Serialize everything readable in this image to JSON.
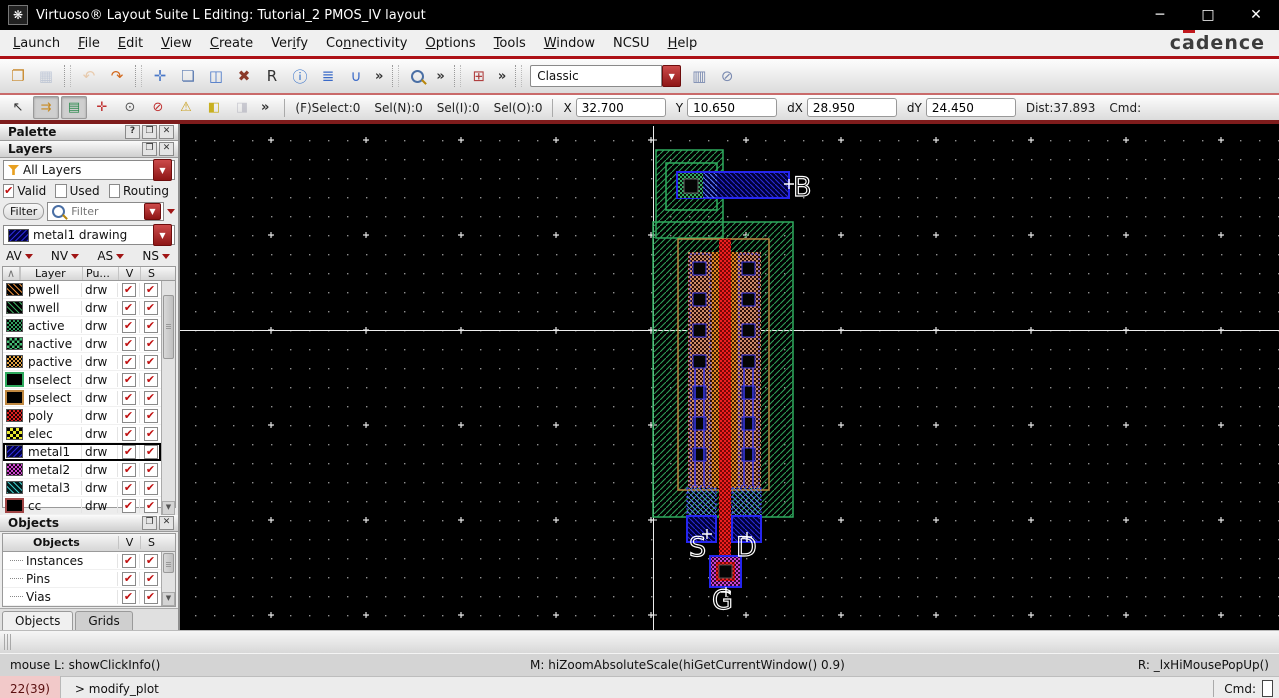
{
  "window": {
    "title": "Virtuoso® Layout Suite L Editing: Tutorial_2 PMOS_IV layout",
    "brand": "cadence",
    "controls": {
      "minimize": "─",
      "maximize": "□",
      "close": "✕"
    }
  },
  "menubar": {
    "items": [
      {
        "label": "Launch",
        "accel": 0
      },
      {
        "label": "File",
        "accel": 0
      },
      {
        "label": "Edit",
        "accel": 0
      },
      {
        "label": "View",
        "accel": 0
      },
      {
        "label": "Create",
        "accel": 0
      },
      {
        "label": "Verify",
        "accel": 3
      },
      {
        "label": "Connectivity",
        "accel": 2
      },
      {
        "label": "Options",
        "accel": 0
      },
      {
        "label": "Tools",
        "accel": 0
      },
      {
        "label": "Window",
        "accel": 0
      },
      {
        "label": "NCSU",
        "accel": -1
      },
      {
        "label": "Help",
        "accel": 0
      }
    ]
  },
  "toolbar_main": {
    "items": [
      {
        "type": "button",
        "name": "open"
      },
      {
        "type": "button",
        "name": "save",
        "disabled": true
      },
      {
        "type": "sep"
      },
      {
        "type": "button",
        "name": "undo",
        "disabled": true
      },
      {
        "type": "button",
        "name": "redo"
      },
      {
        "type": "sep"
      },
      {
        "type": "button",
        "name": "move"
      },
      {
        "type": "button",
        "name": "copy"
      },
      {
        "type": "button",
        "name": "stretch"
      },
      {
        "type": "button",
        "name": "delete"
      },
      {
        "type": "button",
        "name": "properties"
      },
      {
        "type": "button",
        "name": "info"
      },
      {
        "type": "button",
        "name": "align"
      },
      {
        "type": "button",
        "name": "route"
      },
      {
        "type": "chevron"
      },
      {
        "type": "sep"
      },
      {
        "type": "button",
        "name": "zoom-in"
      },
      {
        "type": "chevron"
      },
      {
        "type": "sep"
      },
      {
        "type": "button",
        "name": "create-via"
      },
      {
        "type": "chevron"
      },
      {
        "type": "sep"
      },
      {
        "type": "combo",
        "name": "workspace-select",
        "value": "Classic"
      },
      {
        "type": "button",
        "name": "save-workspace"
      },
      {
        "type": "button",
        "name": "hide-workspace"
      }
    ],
    "overflow_glyph": "»"
  },
  "toolbar_edit": {
    "icons": [
      {
        "name": "select-mode"
      },
      {
        "name": "partial-select",
        "pressed": true
      },
      {
        "name": "layer-visibility",
        "pressed": true
      },
      {
        "name": "gravity"
      },
      {
        "name": "select-filter"
      },
      {
        "name": "stop"
      },
      {
        "name": "check"
      },
      {
        "name": "highlight"
      },
      {
        "name": "probe",
        "disabled": true
      }
    ],
    "selection_status": [
      "(F)Select:0",
      "Sel(N):0",
      "Sel(I):0",
      "Sel(O):0"
    ],
    "coords": [
      {
        "label": "X",
        "value": "32.700"
      },
      {
        "label": "Y",
        "value": "10.650"
      },
      {
        "label": "dX",
        "value": "28.950"
      },
      {
        "label": "dY",
        "value": "24.450"
      }
    ],
    "dist": "Dist:37.893",
    "cmd": "Cmd:"
  },
  "palette": {
    "title": "Palette",
    "header_icons": [
      "?",
      "❐",
      "✕"
    ],
    "layers_panel": {
      "title": "Layers",
      "all_layers": "All Layers",
      "checks": [
        {
          "label": "Valid",
          "checked": true
        },
        {
          "label": "Used",
          "checked": false
        },
        {
          "label": "Routing",
          "checked": false
        }
      ],
      "filter_button": "Filter",
      "filter_placeholder": "Filter",
      "current_layer": "metal1 drawing",
      "mode_buttons": [
        "AV",
        "NV",
        "AS",
        "NS"
      ],
      "table": {
        "headers": {
          "layer": "Layer",
          "purpose": "Pu...",
          "v": "V",
          "s": "S"
        },
        "rows": [
          {
            "name": "pwell",
            "purpose": "drw",
            "v": true,
            "s": true
          },
          {
            "name": "nwell",
            "purpose": "drw",
            "v": true,
            "s": true
          },
          {
            "name": "active",
            "purpose": "drw",
            "v": true,
            "s": true
          },
          {
            "name": "nactive",
            "purpose": "drw",
            "v": true,
            "s": true
          },
          {
            "name": "pactive",
            "purpose": "drw",
            "v": true,
            "s": true
          },
          {
            "name": "nselect",
            "purpose": "drw",
            "v": true,
            "s": true
          },
          {
            "name": "pselect",
            "purpose": "drw",
            "v": true,
            "s": true
          },
          {
            "name": "poly",
            "purpose": "drw",
            "v": true,
            "s": true
          },
          {
            "name": "elec",
            "purpose": "drw",
            "v": true,
            "s": true
          },
          {
            "name": "metal1",
            "purpose": "drw",
            "v": true,
            "s": true,
            "selected": true
          },
          {
            "name": "metal2",
            "purpose": "drw",
            "v": true,
            "s": true
          },
          {
            "name": "metal3",
            "purpose": "drw",
            "v": true,
            "s": true
          },
          {
            "name": "cc",
            "purpose": "drw",
            "v": true,
            "s": true
          }
        ]
      }
    },
    "objects_panel": {
      "title": "Objects",
      "headers": {
        "objects": "Objects",
        "v": "V",
        "s": "S"
      },
      "rows": [
        {
          "name": "Instances",
          "v": true,
          "s": true
        },
        {
          "name": "Pins",
          "v": true,
          "s": true
        },
        {
          "name": "Vias",
          "v": true,
          "s": true
        }
      ],
      "tabs": [
        "Objects",
        "Grids"
      ],
      "active_tab": "Objects"
    }
  },
  "canvas": {
    "pins": {
      "bulk": "B",
      "source": "S",
      "drain": "D",
      "gate": "G"
    }
  },
  "statusbar": {
    "left": "mouse L: showClickInfo()",
    "middle": "M: hiZoomAbsoluteScale(hiGetCurrentWindow() 0.9)",
    "right": "R: _lxHiMousePopUp()"
  },
  "bottombar": {
    "counter": "22(39)",
    "command": "> modify_plot",
    "cmd_label": "Cmd:"
  }
}
